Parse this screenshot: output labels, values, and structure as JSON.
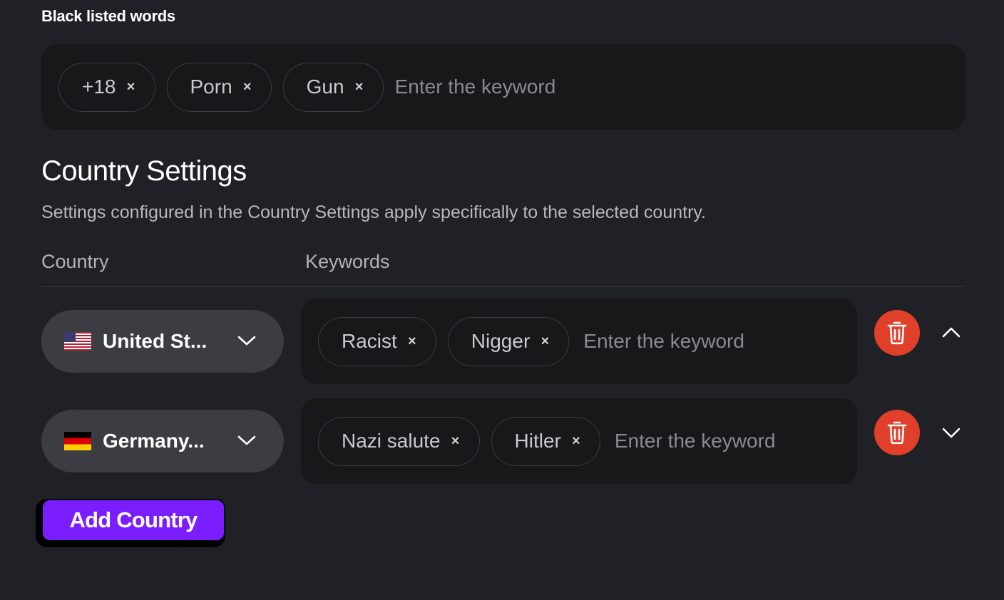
{
  "blacklist": {
    "label": "Black listed words",
    "chips": [
      "+18",
      "Porn",
      "Gun"
    ],
    "placeholder": "Enter the keyword"
  },
  "country_settings": {
    "title": "Country Settings",
    "description": "Settings configured in the Country Settings apply specifically to the selected country.",
    "columns": {
      "country": "Country",
      "keywords": "Keywords"
    },
    "rows": [
      {
        "country": "United St...",
        "flag": "us-flag",
        "chips": [
          "Racist",
          "Nigger"
        ],
        "placeholder": "Enter the keyword",
        "toggle": "chevron-up-icon"
      },
      {
        "country": "Germany...",
        "flag": "de-flag",
        "chips": [
          "Nazi salute",
          "Hitler"
        ],
        "placeholder": "Enter the keyword",
        "toggle": "chevron-down-icon"
      }
    ],
    "add_button": "Add Country"
  },
  "icons": {
    "chip_remove": "×"
  },
  "colors": {
    "background": "#202126",
    "accent": "#7a1dff",
    "delete": "#e0402a"
  }
}
